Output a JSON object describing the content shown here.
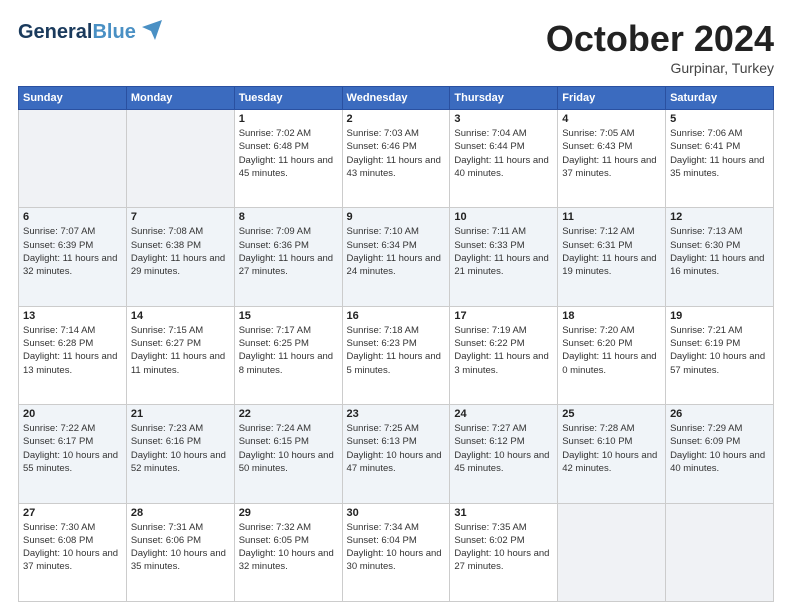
{
  "header": {
    "logo_general": "General",
    "logo_blue": "Blue",
    "month_title": "October 2024",
    "location": "Gurpinar, Turkey"
  },
  "weekdays": [
    "Sunday",
    "Monday",
    "Tuesday",
    "Wednesday",
    "Thursday",
    "Friday",
    "Saturday"
  ],
  "weeks": [
    [
      {
        "day": "",
        "sunrise": "",
        "sunset": "",
        "daylight": ""
      },
      {
        "day": "",
        "sunrise": "",
        "sunset": "",
        "daylight": ""
      },
      {
        "day": "1",
        "sunrise": "Sunrise: 7:02 AM",
        "sunset": "Sunset: 6:48 PM",
        "daylight": "Daylight: 11 hours and 45 minutes."
      },
      {
        "day": "2",
        "sunrise": "Sunrise: 7:03 AM",
        "sunset": "Sunset: 6:46 PM",
        "daylight": "Daylight: 11 hours and 43 minutes."
      },
      {
        "day": "3",
        "sunrise": "Sunrise: 7:04 AM",
        "sunset": "Sunset: 6:44 PM",
        "daylight": "Daylight: 11 hours and 40 minutes."
      },
      {
        "day": "4",
        "sunrise": "Sunrise: 7:05 AM",
        "sunset": "Sunset: 6:43 PM",
        "daylight": "Daylight: 11 hours and 37 minutes."
      },
      {
        "day": "5",
        "sunrise": "Sunrise: 7:06 AM",
        "sunset": "Sunset: 6:41 PM",
        "daylight": "Daylight: 11 hours and 35 minutes."
      }
    ],
    [
      {
        "day": "6",
        "sunrise": "Sunrise: 7:07 AM",
        "sunset": "Sunset: 6:39 PM",
        "daylight": "Daylight: 11 hours and 32 minutes."
      },
      {
        "day": "7",
        "sunrise": "Sunrise: 7:08 AM",
        "sunset": "Sunset: 6:38 PM",
        "daylight": "Daylight: 11 hours and 29 minutes."
      },
      {
        "day": "8",
        "sunrise": "Sunrise: 7:09 AM",
        "sunset": "Sunset: 6:36 PM",
        "daylight": "Daylight: 11 hours and 27 minutes."
      },
      {
        "day": "9",
        "sunrise": "Sunrise: 7:10 AM",
        "sunset": "Sunset: 6:34 PM",
        "daylight": "Daylight: 11 hours and 24 minutes."
      },
      {
        "day": "10",
        "sunrise": "Sunrise: 7:11 AM",
        "sunset": "Sunset: 6:33 PM",
        "daylight": "Daylight: 11 hours and 21 minutes."
      },
      {
        "day": "11",
        "sunrise": "Sunrise: 7:12 AM",
        "sunset": "Sunset: 6:31 PM",
        "daylight": "Daylight: 11 hours and 19 minutes."
      },
      {
        "day": "12",
        "sunrise": "Sunrise: 7:13 AM",
        "sunset": "Sunset: 6:30 PM",
        "daylight": "Daylight: 11 hours and 16 minutes."
      }
    ],
    [
      {
        "day": "13",
        "sunrise": "Sunrise: 7:14 AM",
        "sunset": "Sunset: 6:28 PM",
        "daylight": "Daylight: 11 hours and 13 minutes."
      },
      {
        "day": "14",
        "sunrise": "Sunrise: 7:15 AM",
        "sunset": "Sunset: 6:27 PM",
        "daylight": "Daylight: 11 hours and 11 minutes."
      },
      {
        "day": "15",
        "sunrise": "Sunrise: 7:17 AM",
        "sunset": "Sunset: 6:25 PM",
        "daylight": "Daylight: 11 hours and 8 minutes."
      },
      {
        "day": "16",
        "sunrise": "Sunrise: 7:18 AM",
        "sunset": "Sunset: 6:23 PM",
        "daylight": "Daylight: 11 hours and 5 minutes."
      },
      {
        "day": "17",
        "sunrise": "Sunrise: 7:19 AM",
        "sunset": "Sunset: 6:22 PM",
        "daylight": "Daylight: 11 hours and 3 minutes."
      },
      {
        "day": "18",
        "sunrise": "Sunrise: 7:20 AM",
        "sunset": "Sunset: 6:20 PM",
        "daylight": "Daylight: 11 hours and 0 minutes."
      },
      {
        "day": "19",
        "sunrise": "Sunrise: 7:21 AM",
        "sunset": "Sunset: 6:19 PM",
        "daylight": "Daylight: 10 hours and 57 minutes."
      }
    ],
    [
      {
        "day": "20",
        "sunrise": "Sunrise: 7:22 AM",
        "sunset": "Sunset: 6:17 PM",
        "daylight": "Daylight: 10 hours and 55 minutes."
      },
      {
        "day": "21",
        "sunrise": "Sunrise: 7:23 AM",
        "sunset": "Sunset: 6:16 PM",
        "daylight": "Daylight: 10 hours and 52 minutes."
      },
      {
        "day": "22",
        "sunrise": "Sunrise: 7:24 AM",
        "sunset": "Sunset: 6:15 PM",
        "daylight": "Daylight: 10 hours and 50 minutes."
      },
      {
        "day": "23",
        "sunrise": "Sunrise: 7:25 AM",
        "sunset": "Sunset: 6:13 PM",
        "daylight": "Daylight: 10 hours and 47 minutes."
      },
      {
        "day": "24",
        "sunrise": "Sunrise: 7:27 AM",
        "sunset": "Sunset: 6:12 PM",
        "daylight": "Daylight: 10 hours and 45 minutes."
      },
      {
        "day": "25",
        "sunrise": "Sunrise: 7:28 AM",
        "sunset": "Sunset: 6:10 PM",
        "daylight": "Daylight: 10 hours and 42 minutes."
      },
      {
        "day": "26",
        "sunrise": "Sunrise: 7:29 AM",
        "sunset": "Sunset: 6:09 PM",
        "daylight": "Daylight: 10 hours and 40 minutes."
      }
    ],
    [
      {
        "day": "27",
        "sunrise": "Sunrise: 7:30 AM",
        "sunset": "Sunset: 6:08 PM",
        "daylight": "Daylight: 10 hours and 37 minutes."
      },
      {
        "day": "28",
        "sunrise": "Sunrise: 7:31 AM",
        "sunset": "Sunset: 6:06 PM",
        "daylight": "Daylight: 10 hours and 35 minutes."
      },
      {
        "day": "29",
        "sunrise": "Sunrise: 7:32 AM",
        "sunset": "Sunset: 6:05 PM",
        "daylight": "Daylight: 10 hours and 32 minutes."
      },
      {
        "day": "30",
        "sunrise": "Sunrise: 7:34 AM",
        "sunset": "Sunset: 6:04 PM",
        "daylight": "Daylight: 10 hours and 30 minutes."
      },
      {
        "day": "31",
        "sunrise": "Sunrise: 7:35 AM",
        "sunset": "Sunset: 6:02 PM",
        "daylight": "Daylight: 10 hours and 27 minutes."
      },
      {
        "day": "",
        "sunrise": "",
        "sunset": "",
        "daylight": ""
      },
      {
        "day": "",
        "sunrise": "",
        "sunset": "",
        "daylight": ""
      }
    ]
  ]
}
